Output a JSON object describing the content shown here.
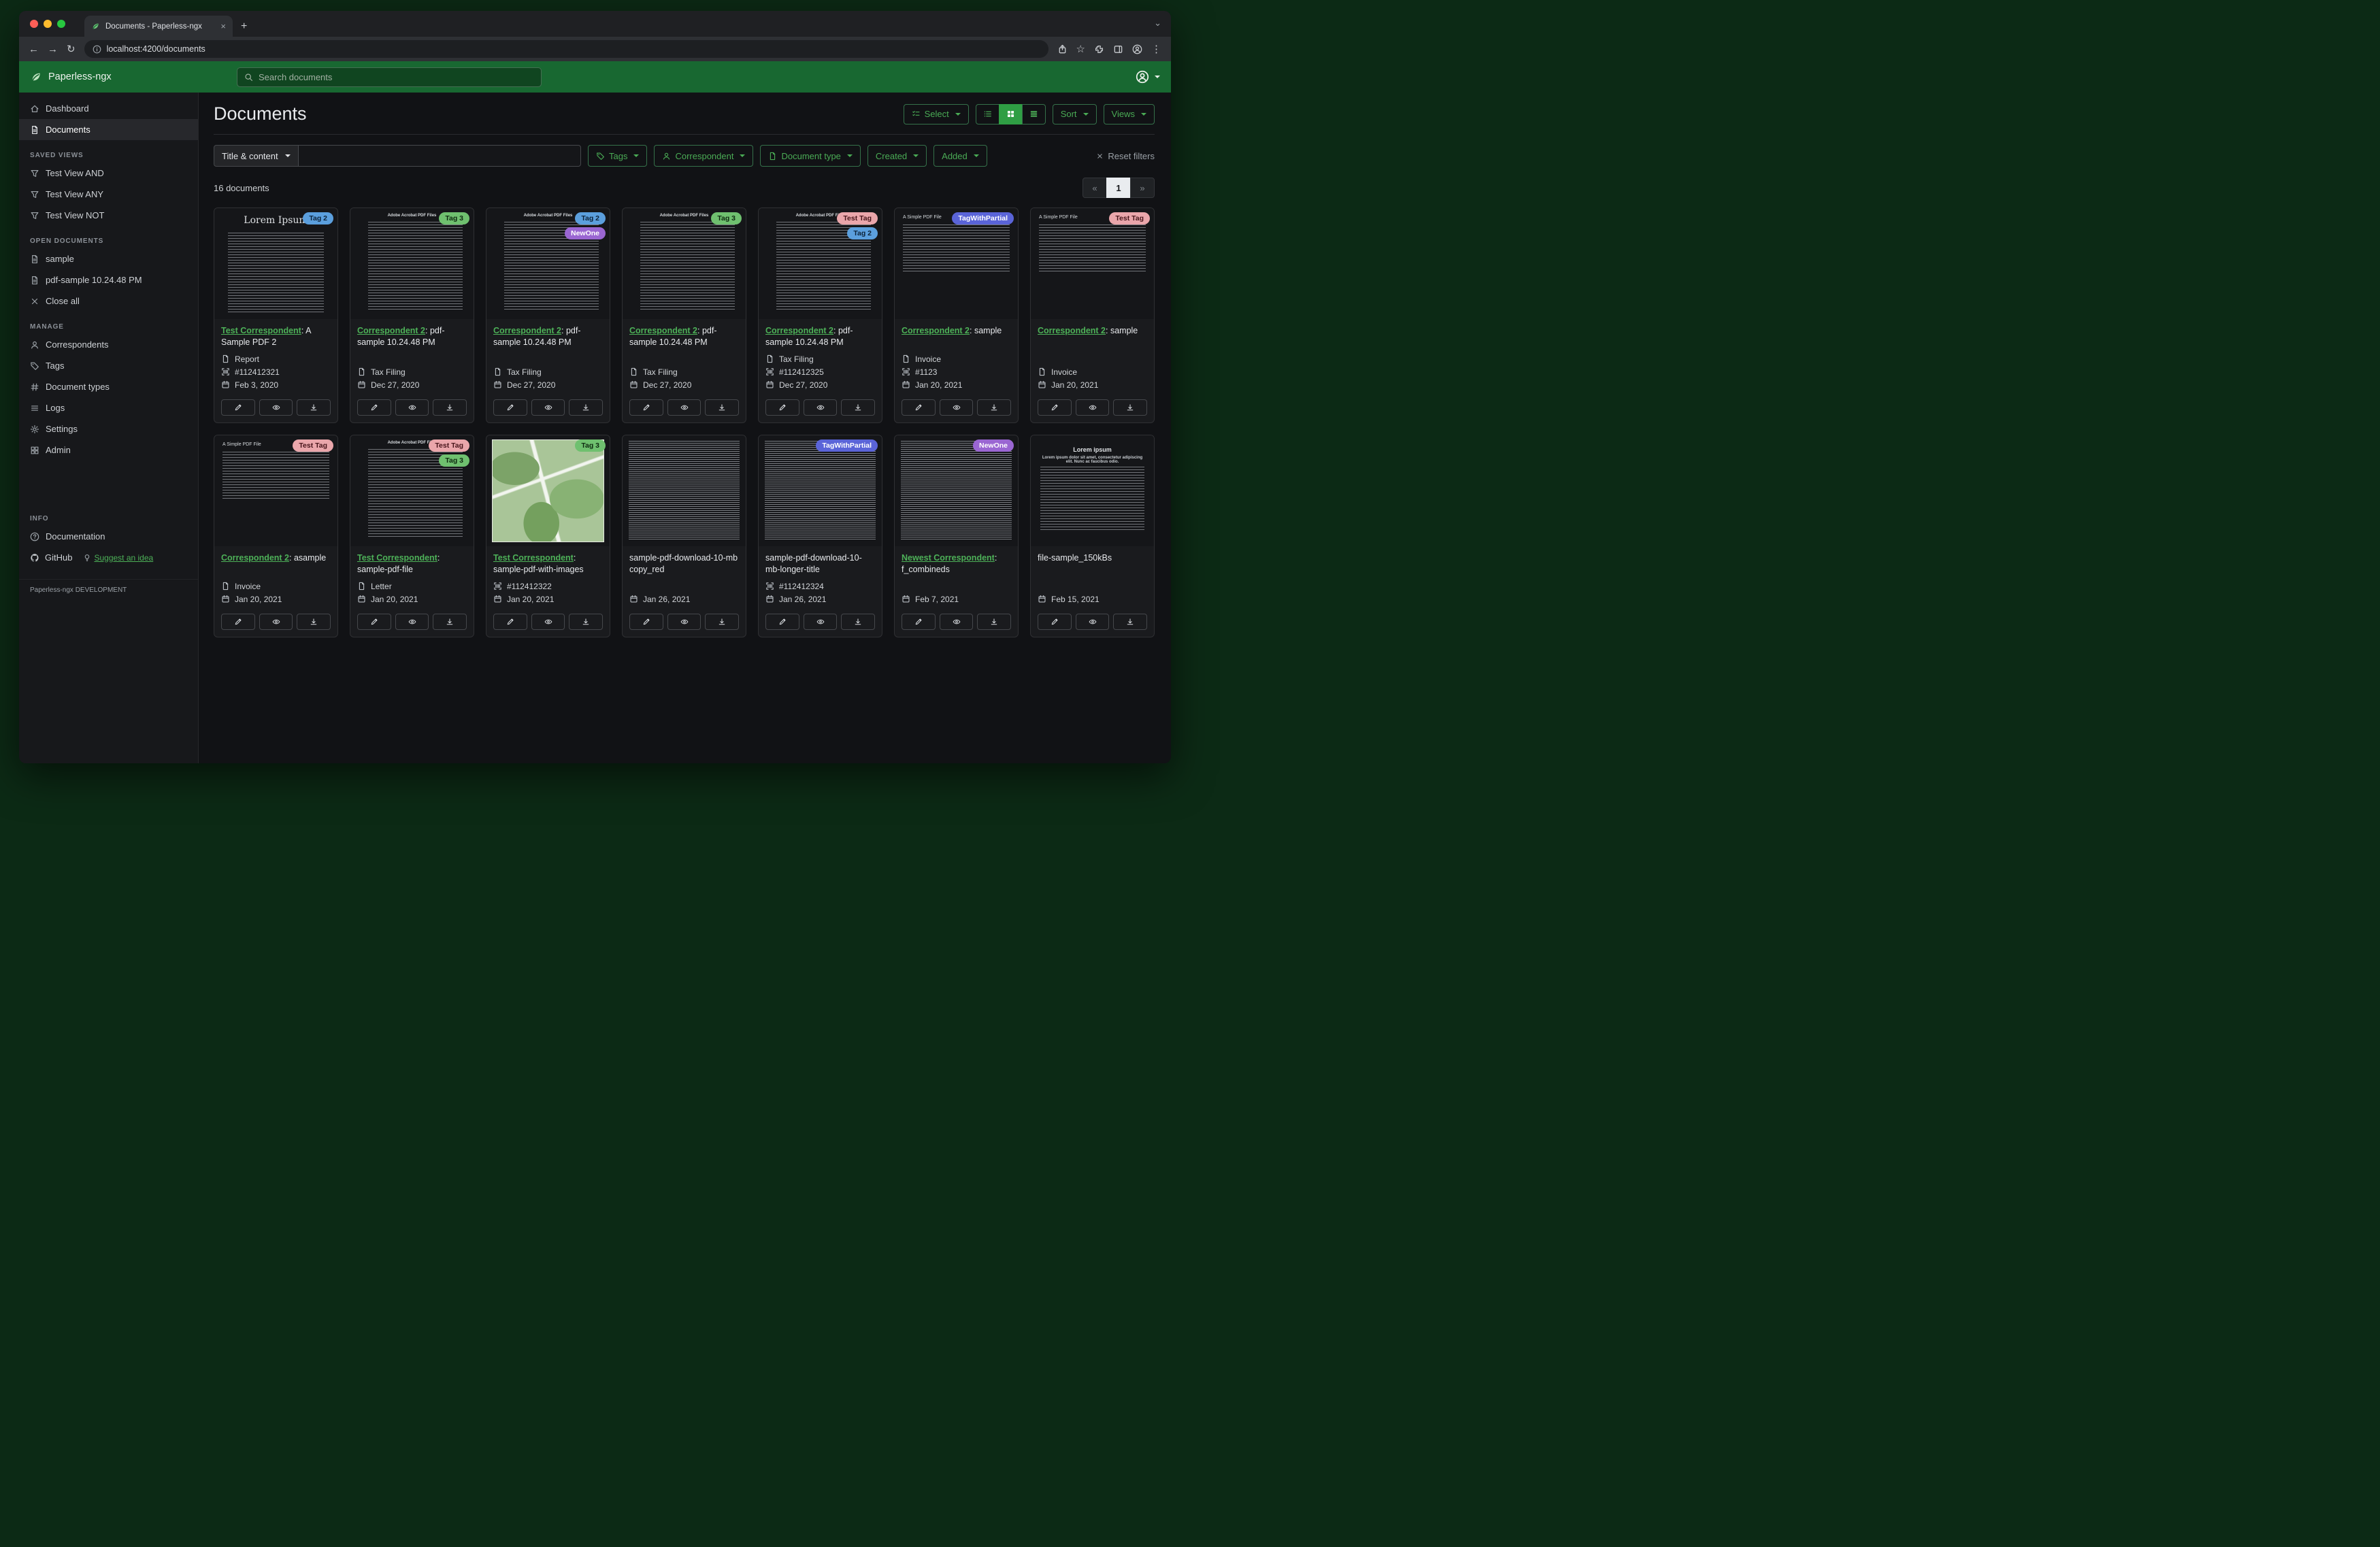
{
  "chrome": {
    "tab_title": "Documents - Paperless-ngx",
    "url": "localhost:4200/documents",
    "glyphs": {
      "back": "←",
      "forward": "→",
      "reload": "↻",
      "star": "☆",
      "kebab": "⋮",
      "chevron": "⌄",
      "new_tab": "+",
      "close_tab": "×"
    }
  },
  "app_header": {
    "brand": "Paperless-ngx",
    "search_placeholder": "Search documents"
  },
  "sidebar": {
    "nav": [
      {
        "label": "Dashboard"
      },
      {
        "label": "Documents"
      }
    ],
    "saved_views": {
      "title": "SAVED VIEWS",
      "items": [
        "Test View AND",
        "Test View ANY",
        "Test View NOT"
      ]
    },
    "open_documents": {
      "title": "OPEN DOCUMENTS",
      "items": [
        "sample",
        "pdf-sample 10.24.48 PM"
      ],
      "close_all": "Close all"
    },
    "manage": {
      "title": "MANAGE",
      "items": [
        "Correspondents",
        "Tags",
        "Document types",
        "Logs",
        "Settings",
        "Admin"
      ]
    },
    "info": {
      "title": "INFO",
      "items": [
        "Documentation"
      ],
      "github": "GitHub",
      "suggest": "Suggest an idea"
    },
    "footer": "Paperless-ngx DEVELOPMENT"
  },
  "content": {
    "title": "Documents",
    "count": "16 documents",
    "actions": {
      "select": "Select",
      "sort": "Sort",
      "views": "Views"
    },
    "filters": {
      "title_content": "Title & content",
      "tags": "Tags",
      "correspondent": "Correspondent",
      "document_type": "Document type",
      "created": "Created",
      "added": "Added",
      "reset": "Reset filters"
    },
    "pagination": {
      "prev": "«",
      "page": "1",
      "next": "»"
    }
  },
  "colors": {
    "header_green": "#186831",
    "accent_green": "#4aab55",
    "link_green": "#4db158",
    "page_bg": "#0c2a15"
  },
  "tag_colors": {
    "Tag 2": {
      "bg": "#5b9fdd",
      "fg": "#0c2238"
    },
    "Tag 3": {
      "bg": "#6fc06f",
      "fg": "#0e2a10"
    },
    "Test Tag": {
      "bg": "#eaa6ab",
      "fg": "#47141a"
    },
    "NewOne": {
      "bg": "#9a66d2",
      "fg": "#ffffff"
    },
    "TagWithPartial": {
      "bg": "#5a64d8",
      "fg": "#ffffff"
    }
  },
  "cards": [
    {
      "thumb": "lorem",
      "thumb_title": "Lorem Ipsum",
      "tags": [
        "Tag 2"
      ],
      "link": "Test Correspondent",
      "title_rest": ": A Sample PDF 2",
      "doc_type": "Report",
      "asn": "#112412321",
      "date": "Feb 3, 2020"
    },
    {
      "thumb": "acrobat",
      "thumb_title": "Adobe Acrobat PDF Files",
      "tags": [
        "Tag 3"
      ],
      "link": "Correspondent 2",
      "title_rest": ": pdf-sample 10.24.48 PM",
      "doc_type": "Tax Filing",
      "date": "Dec 27, 2020"
    },
    {
      "thumb": "acrobat",
      "thumb_title": "Adobe Acrobat PDF Files",
      "tags": [
        "Tag 2",
        "NewOne"
      ],
      "link": "Correspondent 2",
      "title_rest": ": pdf-sample 10.24.48 PM",
      "doc_type": "Tax Filing",
      "date": "Dec 27, 2020"
    },
    {
      "thumb": "acrobat",
      "thumb_title": "Adobe Acrobat PDF Files",
      "tags": [
        "Tag 3"
      ],
      "link": "Correspondent 2",
      "title_rest": ": pdf-sample 10.24.48 PM",
      "doc_type": "Tax Filing",
      "date": "Dec 27, 2020"
    },
    {
      "thumb": "acrobat",
      "thumb_title": "Adobe Acrobat PDF Files",
      "tags": [
        "Test Tag",
        "Tag 2"
      ],
      "link": "Correspondent 2",
      "title_rest": ": pdf-sample 10.24.48 PM",
      "doc_type": "Tax Filing",
      "asn": "#112412325",
      "date": "Dec 27, 2020"
    },
    {
      "thumb": "simple",
      "thumb_title": "A Simple PDF File",
      "tags": [
        "TagWithPartial"
      ],
      "link": "Correspondent 2",
      "title_rest": ": sample",
      "doc_type": "Invoice",
      "asn": "#1123",
      "date": "Jan 20, 2021"
    },
    {
      "thumb": "simple",
      "thumb_title": "A Simple PDF File",
      "tags": [
        "Test Tag"
      ],
      "link": "Correspondent 2",
      "title_rest": ": sample",
      "doc_type": "Invoice",
      "date": "Jan 20, 2021"
    },
    {
      "thumb": "simple",
      "thumb_title": "A Simple PDF File",
      "tags": [
        "Test Tag"
      ],
      "link": "Correspondent 2",
      "title_rest": ": asample",
      "doc_type": "Invoice",
      "date": "Jan 20, 2021"
    },
    {
      "thumb": "acrobat",
      "thumb_title": "Adobe Acrobat PDF Files",
      "tags": [
        "Test Tag",
        "Tag 3"
      ],
      "link": "Test Correspondent",
      "title_rest": ": sample-pdf-file",
      "doc_type": "Letter",
      "date": "Jan 20, 2021"
    },
    {
      "thumb": "map",
      "tags": [
        "Tag 3"
      ],
      "link": "Test Correspondent",
      "title_rest": ": sample-pdf-with-images",
      "asn": "#112412322",
      "date": "Jan 20, 2021"
    },
    {
      "thumb": "dense",
      "tags": [],
      "title_plain": "sample-pdf-download-10-mb copy_red",
      "date": "Jan 26, 2021"
    },
    {
      "thumb": "dense",
      "tags": [
        "TagWithPartial"
      ],
      "title_plain": "sample-pdf-download-10-mb-longer-title",
      "asn": "#112412324",
      "date": "Jan 26, 2021"
    },
    {
      "thumb": "dense",
      "tags": [
        "NewOne"
      ],
      "link": "Newest Correspondent",
      "title_rest": ": f_combineds",
      "date": "Feb 7, 2021"
    },
    {
      "thumb": "center",
      "thumb_title": "Lorem ipsum",
      "thumb_sub": "Lorem ipsum dolor sit amet, consectetur adipiscing elit. Nunc ac faucibus odio.",
      "tags": [],
      "title_plain": "file-sample_150kBs",
      "date": "Feb 15, 2021"
    }
  ]
}
